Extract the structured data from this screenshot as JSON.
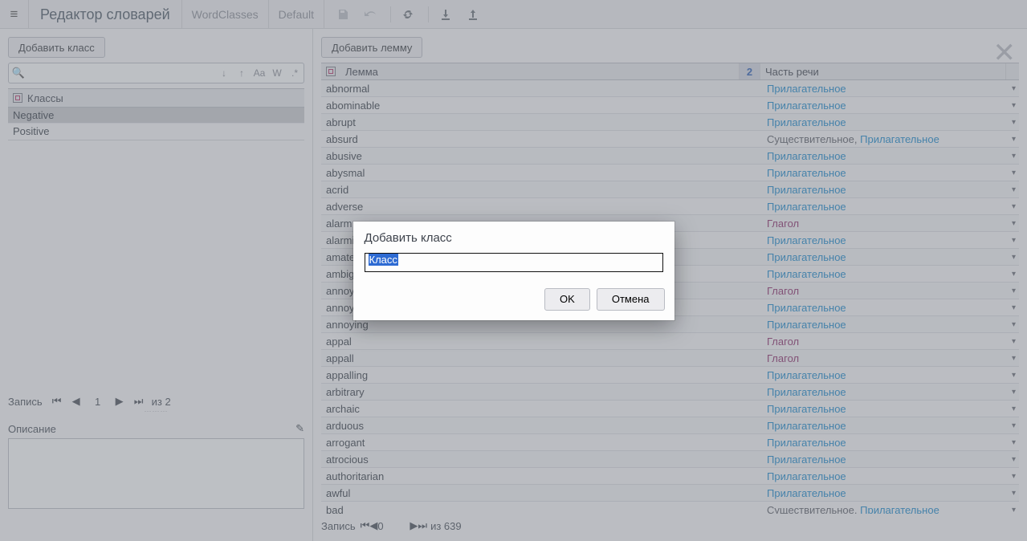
{
  "header": {
    "title": "Редактор словарей",
    "crumb1": "WordClasses",
    "crumb2": "Default"
  },
  "left": {
    "add_class_btn": "Добавить класс",
    "search_placeholder": "",
    "classes_header": "Классы",
    "classes": [
      "Negative",
      "Positive"
    ],
    "selected_class_index": 0,
    "record_label": "Запись",
    "record_page": "1",
    "record_total": "из 2",
    "description_label": "Описание"
  },
  "right": {
    "add_lemma_btn": "Добавить лемму",
    "col_lemma": "Лемма",
    "col_pos": "Часть речи",
    "col_pos_badge": "2",
    "rows": [
      {
        "lemma": "abnormal",
        "pos": [
          {
            "t": "Прилагательное",
            "c": "adj"
          }
        ]
      },
      {
        "lemma": "abominable",
        "pos": [
          {
            "t": "Прилагательное",
            "c": "adj"
          }
        ]
      },
      {
        "lemma": "abrupt",
        "pos": [
          {
            "t": "Прилагательное",
            "c": "adj"
          }
        ]
      },
      {
        "lemma": "absurd",
        "pos": [
          {
            "t": "Существительное",
            "c": "noun"
          },
          {
            "t": "Прилагательное",
            "c": "adj"
          }
        ]
      },
      {
        "lemma": "abusive",
        "pos": [
          {
            "t": "Прилагательное",
            "c": "adj"
          }
        ]
      },
      {
        "lemma": "abysmal",
        "pos": [
          {
            "t": "Прилагательное",
            "c": "adj"
          }
        ]
      },
      {
        "lemma": "acrid",
        "pos": [
          {
            "t": "Прилагательное",
            "c": "adj"
          }
        ]
      },
      {
        "lemma": "adverse",
        "pos": [
          {
            "t": "Прилагательное",
            "c": "adj"
          }
        ]
      },
      {
        "lemma": "alarm",
        "pos": [
          {
            "t": "Глагол",
            "c": "verb"
          }
        ]
      },
      {
        "lemma": "alarming",
        "pos": [
          {
            "t": "Прилагательное",
            "c": "adj"
          }
        ]
      },
      {
        "lemma": "amateurish",
        "pos": [
          {
            "t": "Прилагательное",
            "c": "adj"
          }
        ]
      },
      {
        "lemma": "ambiguous",
        "pos": [
          {
            "t": "Прилагательное",
            "c": "adj"
          }
        ]
      },
      {
        "lemma": "annoy",
        "pos": [
          {
            "t": "Глагол",
            "c": "verb"
          }
        ]
      },
      {
        "lemma": "annoyed",
        "pos": [
          {
            "t": "Прилагательное",
            "c": "adj"
          }
        ]
      },
      {
        "lemma": "annoying",
        "pos": [
          {
            "t": "Прилагательное",
            "c": "adj"
          }
        ]
      },
      {
        "lemma": "appal",
        "pos": [
          {
            "t": "Глагол",
            "c": "verb"
          }
        ]
      },
      {
        "lemma": "appall",
        "pos": [
          {
            "t": "Глагол",
            "c": "verb"
          }
        ]
      },
      {
        "lemma": "appalling",
        "pos": [
          {
            "t": "Прилагательное",
            "c": "adj"
          }
        ]
      },
      {
        "lemma": "arbitrary",
        "pos": [
          {
            "t": "Прилагательное",
            "c": "adj"
          }
        ]
      },
      {
        "lemma": "archaic",
        "pos": [
          {
            "t": "Прилагательное",
            "c": "adj"
          }
        ]
      },
      {
        "lemma": "arduous",
        "pos": [
          {
            "t": "Прилагательное",
            "c": "adj"
          }
        ]
      },
      {
        "lemma": "arrogant",
        "pos": [
          {
            "t": "Прилагательное",
            "c": "adj"
          }
        ]
      },
      {
        "lemma": "atrocious",
        "pos": [
          {
            "t": "Прилагательное",
            "c": "adj"
          }
        ]
      },
      {
        "lemma": "authoritarian",
        "pos": [
          {
            "t": "Прилагательное",
            "c": "adj"
          }
        ]
      },
      {
        "lemma": "awful",
        "pos": [
          {
            "t": "Прилагательное",
            "c": "adj"
          }
        ]
      },
      {
        "lemma": "bad",
        "pos": [
          {
            "t": "Существительное",
            "c": "noun"
          },
          {
            "t": "Прилагательное",
            "c": "adj"
          }
        ]
      }
    ],
    "record_label": "Запись",
    "record_page": "0",
    "record_total": "из 639"
  },
  "modal": {
    "title": "Добавить класс",
    "input_value": "Класс",
    "ok": "OK",
    "cancel": "Отмена"
  }
}
